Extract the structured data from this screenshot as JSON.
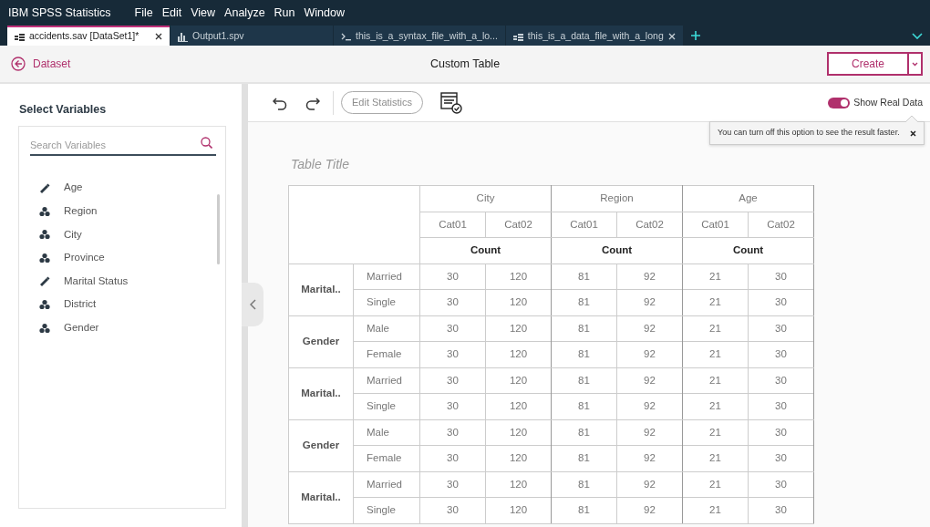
{
  "app": {
    "name": "IBM SPSS Statistics",
    "menu": [
      "File",
      "Edit",
      "View",
      "Analyze",
      "Run",
      "Window"
    ]
  },
  "tabs": [
    {
      "label": "accidents.sav [DataSet1]*",
      "kind": "data",
      "selected": true,
      "closable": true
    },
    {
      "label": "Output1.spv",
      "kind": "output",
      "selected": false,
      "closable": false
    },
    {
      "label": "this_is_a_syntax_file_with_a_lo...",
      "kind": "syntax",
      "selected": false,
      "closable": false
    },
    {
      "label": "this_is_a_data_file_with_a_long",
      "kind": "data",
      "selected": false,
      "closable": true
    }
  ],
  "header": {
    "back": "Dataset",
    "title": "Custom Table",
    "primary": "Create"
  },
  "sidebar": {
    "title": "Select Variables",
    "search": {
      "placeholder": "Search Variables"
    },
    "variables": [
      {
        "name": "Age",
        "kind": "scale"
      },
      {
        "name": "Region",
        "kind": "nominal"
      },
      {
        "name": "City",
        "kind": "nominal"
      },
      {
        "name": "Province",
        "kind": "nominal"
      },
      {
        "name": "Marital Status",
        "kind": "scale"
      },
      {
        "name": "District",
        "kind": "nominal"
      },
      {
        "name": "Gender",
        "kind": "nominal"
      }
    ]
  },
  "toolbar": {
    "edit_statistics": {
      "label": "Edit Statistics",
      "disabled": true
    },
    "toggle": {
      "label": "Show Real Data",
      "on": true
    },
    "tooltip": "You can turn off this option to see the result faster."
  },
  "table": {
    "title_placeholder": "Table Title",
    "columns": [
      {
        "name": "City",
        "categories": [
          "Cat01",
          "Cat02"
        ],
        "statistic": "Count"
      },
      {
        "name": "Region",
        "categories": [
          "Cat01",
          "Cat02"
        ],
        "statistic": "Count"
      },
      {
        "name": "Age",
        "categories": [
          "Cat01",
          "Cat02"
        ],
        "statistic": "Count"
      }
    ],
    "row_groups": [
      {
        "label": "Marital..",
        "rows": [
          {
            "label": "Married",
            "values": [
              "30",
              "120",
              "81",
              "92",
              "21",
              "30"
            ]
          },
          {
            "label": "Single",
            "values": [
              "30",
              "120",
              "81",
              "92",
              "21",
              "30"
            ]
          }
        ]
      },
      {
        "label": "Gender",
        "rows": [
          {
            "label": "Male",
            "values": [
              "30",
              "120",
              "81",
              "92",
              "21",
              "30"
            ]
          },
          {
            "label": "Female",
            "values": [
              "30",
              "120",
              "81",
              "92",
              "21",
              "30"
            ]
          }
        ]
      },
      {
        "label": "Marital..",
        "rows": [
          {
            "label": "Married",
            "values": [
              "30",
              "120",
              "81",
              "92",
              "21",
              "30"
            ]
          },
          {
            "label": "Single",
            "values": [
              "30",
              "120",
              "81",
              "92",
              "21",
              "30"
            ]
          }
        ]
      },
      {
        "label": "Gender",
        "rows": [
          {
            "label": "Male",
            "values": [
              "30",
              "120",
              "81",
              "92",
              "21",
              "30"
            ]
          },
          {
            "label": "Female",
            "values": [
              "30",
              "120",
              "81",
              "92",
              "21",
              "30"
            ]
          }
        ]
      },
      {
        "label": "Marital..",
        "rows": [
          {
            "label": "Married",
            "values": [
              "30",
              "120",
              "81",
              "92",
              "21",
              "30"
            ]
          },
          {
            "label": "Single",
            "values": [
              "30",
              "120",
              "81",
              "92",
              "21",
              "30"
            ]
          }
        ]
      }
    ]
  }
}
